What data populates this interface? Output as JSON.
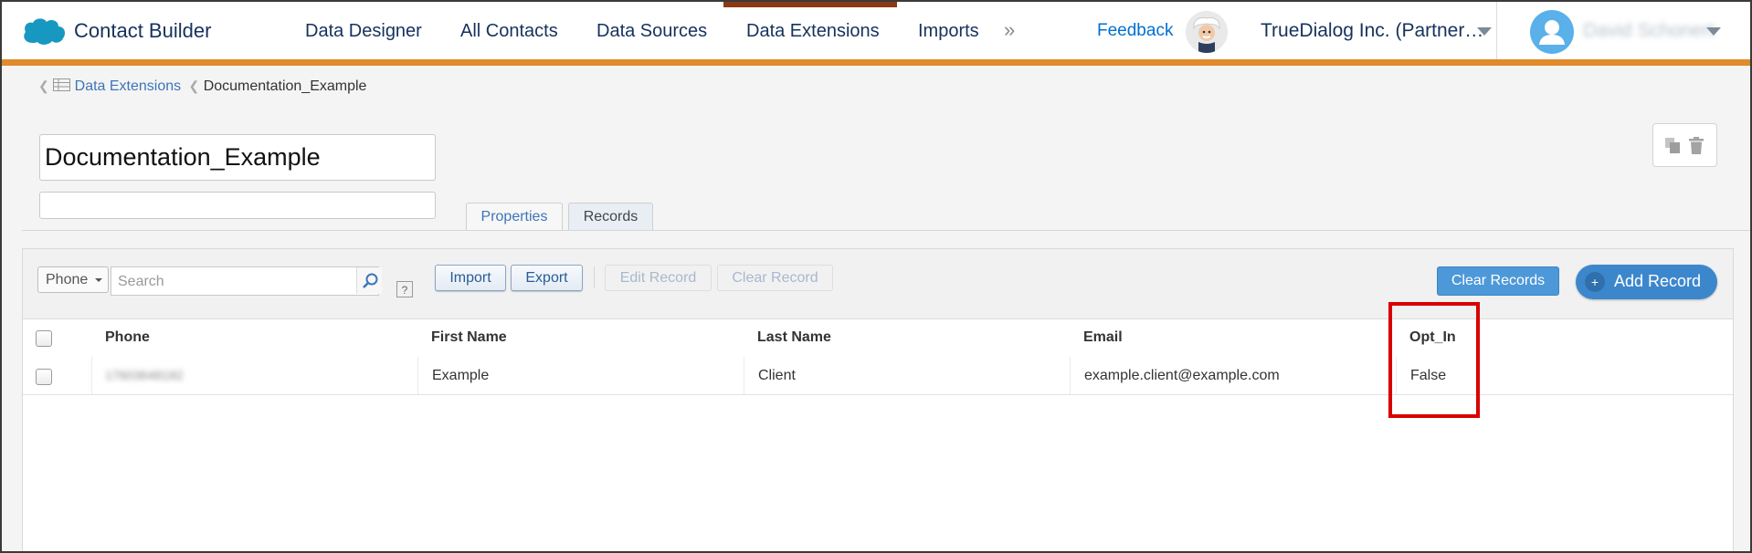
{
  "header": {
    "app_title": "Contact Builder",
    "nav": [
      "Data Designer",
      "All Contacts",
      "Data Sources",
      "Data Extensions",
      "Imports"
    ],
    "active_nav": "Data Extensions",
    "more": "»",
    "feedback": "Feedback",
    "org": "TrueDialog Inc. (Partner…",
    "user_name": "David Schonert"
  },
  "breadcrumb": {
    "root": "Data Extensions",
    "current": "Documentation_Example"
  },
  "extension": {
    "name": "Documentation_Example",
    "description": ""
  },
  "tabs": [
    "Properties",
    "Records"
  ],
  "active_tab": "Records",
  "toolbar": {
    "filter_field": "Phone",
    "search_placeholder": "Search",
    "help": "?",
    "import": "Import",
    "export": "Export",
    "edit_record": "Edit Record",
    "clear_record": "Clear Record",
    "clear_records": "Clear Records",
    "add_record": "Add Record"
  },
  "table": {
    "columns": [
      "Phone",
      "First Name",
      "Last Name",
      "Email",
      "Opt_In"
    ],
    "rows": [
      [
        "17603648182",
        "Example",
        "Client",
        "example.client@example.com",
        "False"
      ]
    ]
  },
  "colors": {
    "accent_bar": "#e08a2a",
    "active_tab_top": "#8b3a16",
    "primary_button": "#3c87cc",
    "link": "#3d75b8",
    "annotation": "#d90000"
  }
}
